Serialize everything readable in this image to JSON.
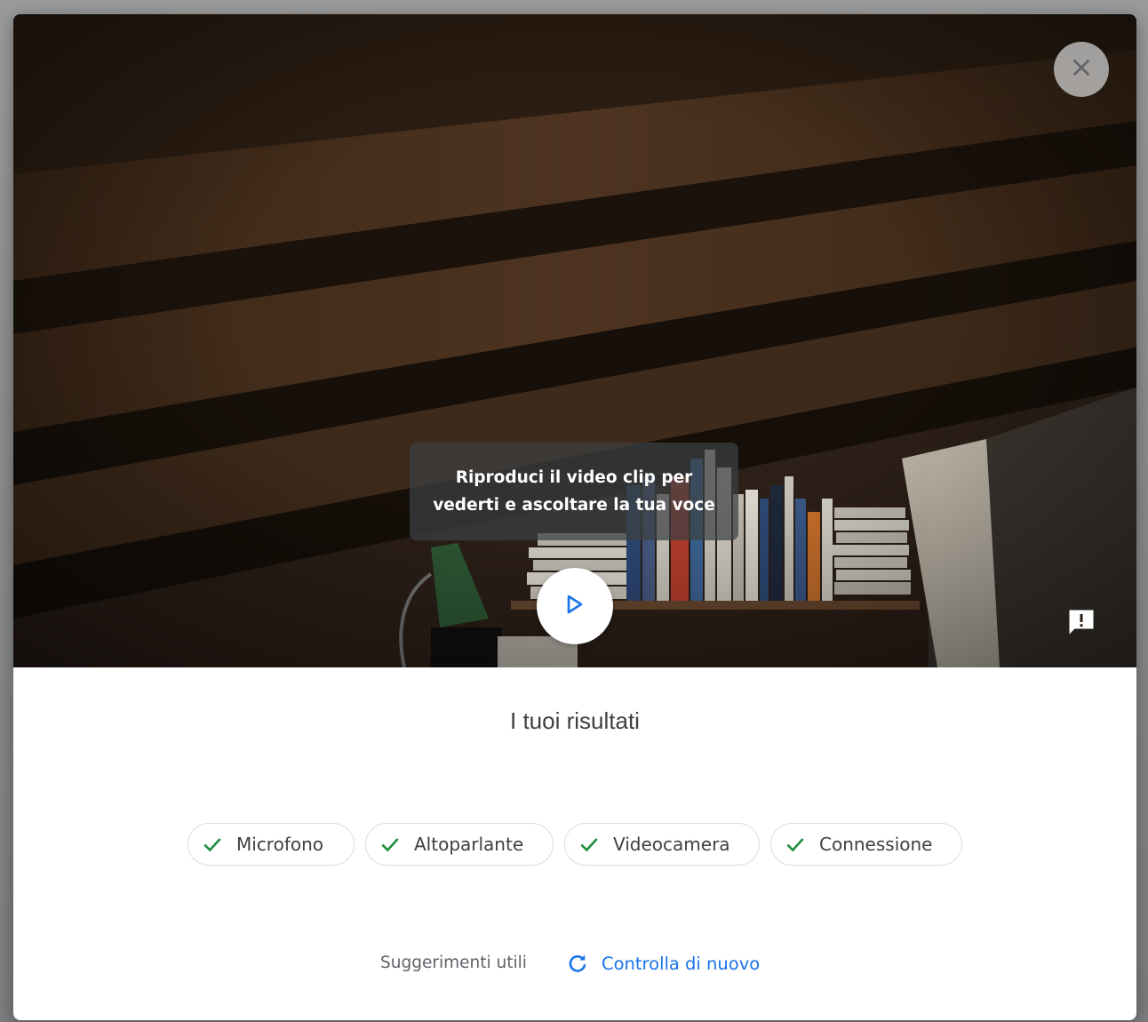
{
  "video": {
    "tooltip_text": "Riproduci il video clip per vederti e ascoltare la tua voce",
    "icons": {
      "close": "close-icon",
      "play": "play-icon",
      "feedback": "feedback-icon"
    }
  },
  "results": {
    "title": "I tuoi risultati",
    "checks": [
      {
        "label": "Microfono",
        "status": "ok"
      },
      {
        "label": "Altoparlante",
        "status": "ok"
      },
      {
        "label": "Videocamera",
        "status": "ok"
      },
      {
        "label": "Connessione",
        "status": "ok"
      }
    ]
  },
  "footer": {
    "tips_label": "Suggerimenti utili",
    "recheck_label": "Controlla di nuovo"
  },
  "colors": {
    "accent_blue": "#1a73e8",
    "check_green": "#1e8e3e",
    "text_dark": "#3c4043",
    "text_muted": "#5f6368"
  }
}
